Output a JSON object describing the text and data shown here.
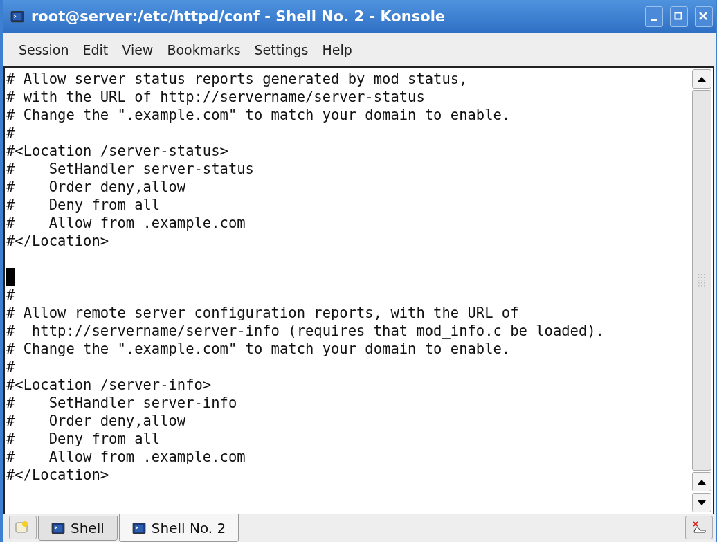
{
  "window": {
    "title": "root@server:/etc/httpd/conf - Shell No. 2 - Konsole"
  },
  "menu": [
    "Session",
    "Edit",
    "View",
    "Bookmarks",
    "Settings",
    "Help"
  ],
  "terminal": {
    "lines": [
      {
        "kind": "text",
        "text": "# Allow server status reports generated by mod_status,"
      },
      {
        "kind": "text",
        "text": "# with the URL of http://servername/server-status"
      },
      {
        "kind": "text",
        "text": "# Change the \".example.com\" to match your domain to enable."
      },
      {
        "kind": "text",
        "text": "#"
      },
      {
        "kind": "text",
        "text": "#<Location /server-status>"
      },
      {
        "kind": "text",
        "text": "#    SetHandler server-status"
      },
      {
        "kind": "text",
        "text": "#    Order deny,allow"
      },
      {
        "kind": "text",
        "text": "#    Deny from all"
      },
      {
        "kind": "text",
        "text": "#    Allow from .example.com"
      },
      {
        "kind": "text",
        "text": "#</Location>"
      },
      {
        "kind": "blank"
      },
      {
        "kind": "cursor"
      },
      {
        "kind": "text",
        "text": "#"
      },
      {
        "kind": "text",
        "text": "# Allow remote server configuration reports, with the URL of"
      },
      {
        "kind": "text",
        "text": "#  http://servername/server-info (requires that mod_info.c be loaded)."
      },
      {
        "kind": "text",
        "text": "# Change the \".example.com\" to match your domain to enable."
      },
      {
        "kind": "text",
        "text": "#"
      },
      {
        "kind": "text",
        "text": "#<Location /server-info>"
      },
      {
        "kind": "text",
        "text": "#    SetHandler server-info"
      },
      {
        "kind": "text",
        "text": "#    Order deny,allow"
      },
      {
        "kind": "text",
        "text": "#    Deny from all"
      },
      {
        "kind": "text",
        "text": "#    Allow from .example.com"
      },
      {
        "kind": "text",
        "text": "#</Location>"
      }
    ]
  },
  "tabs": [
    {
      "label": "Shell",
      "selected": false
    },
    {
      "label": "Shell No. 2",
      "selected": true
    }
  ]
}
